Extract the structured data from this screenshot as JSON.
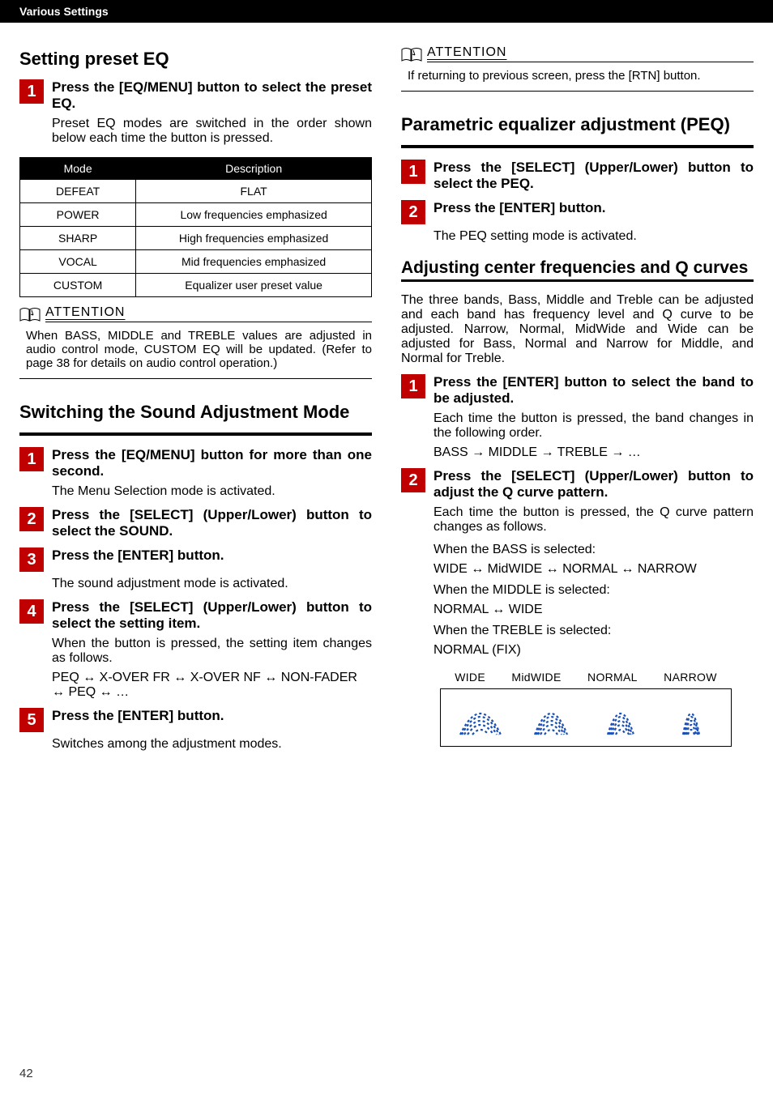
{
  "header": {
    "section": "Various Settings"
  },
  "left": {
    "title1": "Setting preset EQ",
    "step1_lead": "Press the [EQ/MENU] button to select the preset EQ.",
    "step1_text": "Preset EQ modes are switched in the order shown below each time the button is pressed.",
    "table": {
      "headers": [
        "Mode",
        "Description"
      ],
      "rows": [
        [
          "DEFEAT",
          "FLAT"
        ],
        [
          "POWER",
          "Low frequencies emphasized"
        ],
        [
          "SHARP",
          "High frequencies emphasized"
        ],
        [
          "VOCAL",
          "Mid frequencies emphasized"
        ],
        [
          "CUSTOM",
          "Equalizer user preset value"
        ]
      ]
    },
    "attention_label": "ATTENTION",
    "attention1": "When BASS, MIDDLE and TREBLE values are adjusted in audio control mode, CUSTOM EQ will be updated. (Refer to page 38 for details on audio control operation.)",
    "title2": "Switching the Sound Adjustment Mode",
    "s2_step1_lead": "Press the [EQ/MENU] button for more than one second.",
    "s2_step1_text": "The Menu Selection mode is activated.",
    "s2_step2_lead": "Press the [SELECT] (Upper/Lower) button to select the SOUND.",
    "s2_step3_lead": "Press the [ENTER] button.",
    "s2_step3_text": "The sound adjustment mode is activated.",
    "s2_step4_lead": "Press the [SELECT] (Upper/Lower) button to select the setting item.",
    "s2_step4_text": "When the button is pressed, the setting item changes as follows.",
    "s2_step4_seq": "PEQ ↔ X-OVER FR ↔ X-OVER NF ↔ NON-FADER ↔ PEQ ↔ …",
    "s2_step5_lead": "Press the [ENTER] button.",
    "s2_step5_text": "Switches among the adjustment modes."
  },
  "right": {
    "attention_label": "ATTENTION",
    "attention_top": "If returning to previous screen, press the [RTN] button.",
    "title1": "Parametric equalizer adjustment (PEQ)",
    "r1_step1_lead": "Press the [SELECT] (Upper/Lower) button to select the PEQ.",
    "r1_step2_lead": "Press the [ENTER] button.",
    "r1_step2_text": "The PEQ setting mode is activated.",
    "title2": "Adjusting center frequencies and Q curves",
    "intro2": "The three bands, Bass, Middle and Treble can be adjusted and each band has frequency level and Q curve to be adjusted. Narrow, Normal, MidWide and Wide can be adjusted for Bass, Normal and Narrow for Middle, and Normal for Treble.",
    "r2_step1_lead": "Press the [ENTER] button to select the band to be adjusted.",
    "r2_step1_text": "Each time the button is pressed, the band changes in the following order.",
    "r2_step1_seq": "BASS → MIDDLE → TREBLE → …",
    "r2_step2_lead": "Press the [SELECT] (Upper/Lower) button to adjust the Q curve pattern.",
    "r2_step2_text": "Each time the button is pressed, the Q curve pattern changes as follows.",
    "bass_label": "When the BASS is selected:",
    "bass_seq": "WIDE ↔ MidWIDE ↔ NORMAL ↔ NARROW",
    "middle_label": "When the MIDDLE is selected:",
    "middle_seq": "NORMAL ↔ WIDE",
    "treble_label": "When the TREBLE is selected:",
    "treble_seq": "NORMAL (FIX)",
    "curve_labels": [
      "WIDE",
      "MidWIDE",
      "NORMAL",
      "NARROW"
    ]
  },
  "page_number": "42",
  "chart_data": {
    "type": "table",
    "title": "Preset EQ Modes",
    "columns": [
      "Mode",
      "Description"
    ],
    "rows": [
      [
        "DEFEAT",
        "FLAT"
      ],
      [
        "POWER",
        "Low frequencies emphasized"
      ],
      [
        "SHARP",
        "High frequencies emphasized"
      ],
      [
        "VOCAL",
        "Mid frequencies emphasized"
      ],
      [
        "CUSTOM",
        "Equalizer user preset value"
      ]
    ]
  }
}
